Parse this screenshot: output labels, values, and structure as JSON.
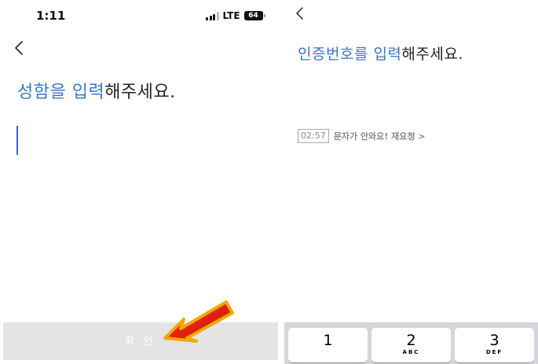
{
  "left_screen": {
    "status_bar": {
      "time": "1:11",
      "network": "LTE",
      "battery": "64"
    },
    "title": {
      "highlight": "성함을 입력",
      "rest": "해주세요."
    },
    "confirm_button": "확 인",
    "icons": [
      "back-chevron-icon",
      "red-arrow-annotation"
    ]
  },
  "right_screen": {
    "title": {
      "highlight": "인증번호를 입력",
      "rest": "해주세요."
    },
    "timer": "02:57",
    "resend_link": "문자가 안와요! 재요청 >",
    "keypad": [
      {
        "number": "1",
        "letters": ""
      },
      {
        "number": "2",
        "letters": "ABC"
      },
      {
        "number": "3",
        "letters": "DEF"
      }
    ]
  },
  "colors": {
    "accent": "#3a78c4",
    "caret": "#3b5fd9",
    "button_disabled": "#e4e4e4",
    "annotation_arrow": "#e8130e"
  }
}
